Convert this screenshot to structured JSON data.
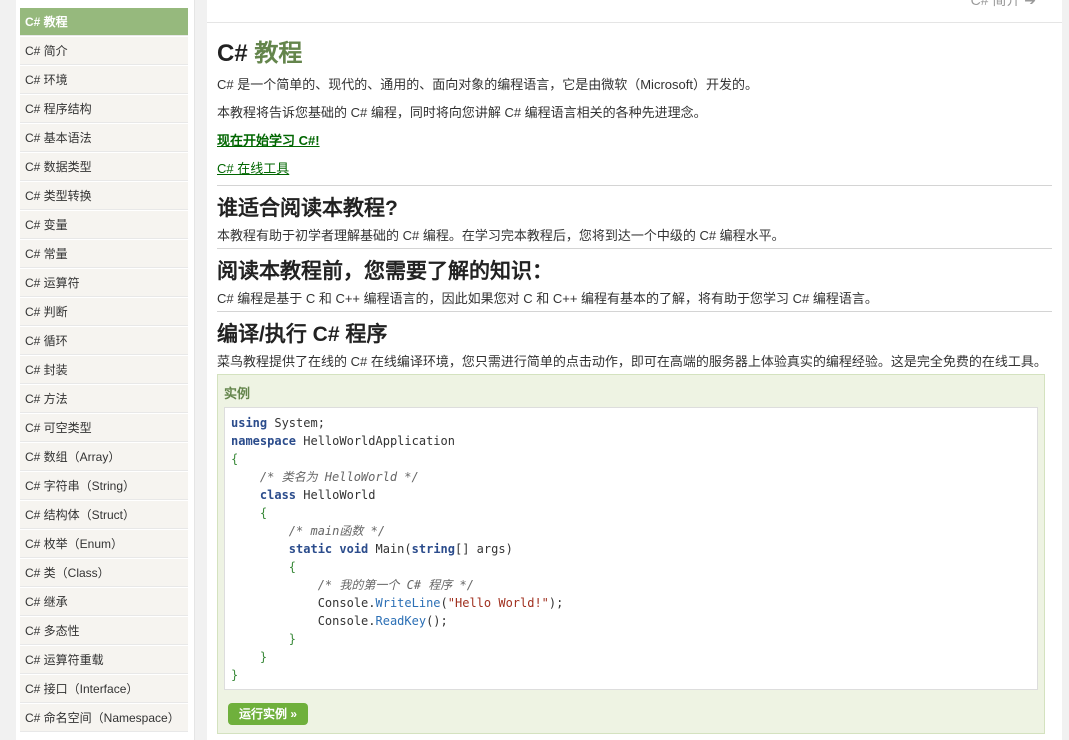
{
  "sidebar": {
    "items": [
      {
        "label": "C# 教程"
      },
      {
        "label": "C# 简介"
      },
      {
        "label": "C# 环境"
      },
      {
        "label": "C# 程序结构"
      },
      {
        "label": "C# 基本语法"
      },
      {
        "label": "C# 数据类型"
      },
      {
        "label": "C# 类型转换"
      },
      {
        "label": "C# 变量"
      },
      {
        "label": "C# 常量"
      },
      {
        "label": "C# 运算符"
      },
      {
        "label": "C# 判断"
      },
      {
        "label": "C# 循环"
      },
      {
        "label": "C# 封装"
      },
      {
        "label": "C# 方法"
      },
      {
        "label": "C# 可空类型"
      },
      {
        "label": "C# 数组（Array）"
      },
      {
        "label": "C# 字符串（String）"
      },
      {
        "label": "C# 结构体（Struct）"
      },
      {
        "label": "C# 枚举（Enum）"
      },
      {
        "label": "C# 类（Class）"
      },
      {
        "label": "C# 继承"
      },
      {
        "label": "C# 多态性"
      },
      {
        "label": "C# 运算符重载"
      },
      {
        "label": "C# 接口（Interface）"
      },
      {
        "label": "C# 命名空间（Namespace）"
      }
    ],
    "active_index": 0
  },
  "nav": {
    "next_label": "C# 简介"
  },
  "main": {
    "title_prefix": "C# ",
    "title_highlight": "教程",
    "intro_1": "C# 是一个简单的、现代的、通用的、面向对象的编程语言，它是由微软（Microsoft）开发的。",
    "intro_2": "本教程将告诉您基础的 C# 编程，同时将向您讲解 C# 编程语言相关的各种先进理念。",
    "start_link": "现在开始学习 C#!",
    "online_tool_link": "C# 在线工具",
    "section_1_title": "谁适合阅读本教程?",
    "section_1_text": "本教程有助于初学者理解基础的 C# 编程。在学习完本教程后，您将到达一个中级的 C# 编程水平。",
    "section_2_title": "阅读本教程前，您需要了解的知识：",
    "section_2_text": "C# 编程是基于 C 和 C++ 编程语言的，因此如果您对 C 和 C++ 编程有基本的了解，将有助于您学习 C# 编程语言。",
    "section_3_title": "编译/执行 C# 程序",
    "section_3_text": "菜鸟教程提供了在线的 C# 在线编译环境，您只需进行简单的点击动作，即可在高端的服务器上体验真实的编程经验。这是完全免费的在线工具。",
    "example_title": "实例",
    "run_button": "运行实例 »"
  },
  "code": {
    "l1_kw": "using",
    "l1_rest": " System;",
    "l2_kw": "namespace",
    "l2_rest": " HelloWorldApplication",
    "l3": "{",
    "l4_cm": "    /* 类名为 HelloWorld */",
    "l5_kw": "    class",
    "l5_rest": " HelloWorld",
    "l6": "    {",
    "l7_cm": "        /* main函数 */",
    "l8_kw1": "        static",
    "l8_kw2": " void",
    "l8_name": " Main(",
    "l8_kw3": "string",
    "l8_rest": "[] args)",
    "l9": "        {",
    "l10_cm": "            /* 我的第一个 C# 程序 */",
    "l11_a": "            Console.",
    "l11_fn": "WriteLine",
    "l11_b": "(",
    "l11_str": "\"Hello World!\"",
    "l11_c": ");",
    "l12_a": "            Console.",
    "l12_fn": "ReadKey",
    "l12_b": "();",
    "l13": "        }",
    "l14": "    }",
    "l15": "}"
  },
  "colors": {
    "accent": "#96b97d",
    "title_highlight": "#64854c",
    "link": "#006600",
    "run_button": "#6fb03c"
  }
}
